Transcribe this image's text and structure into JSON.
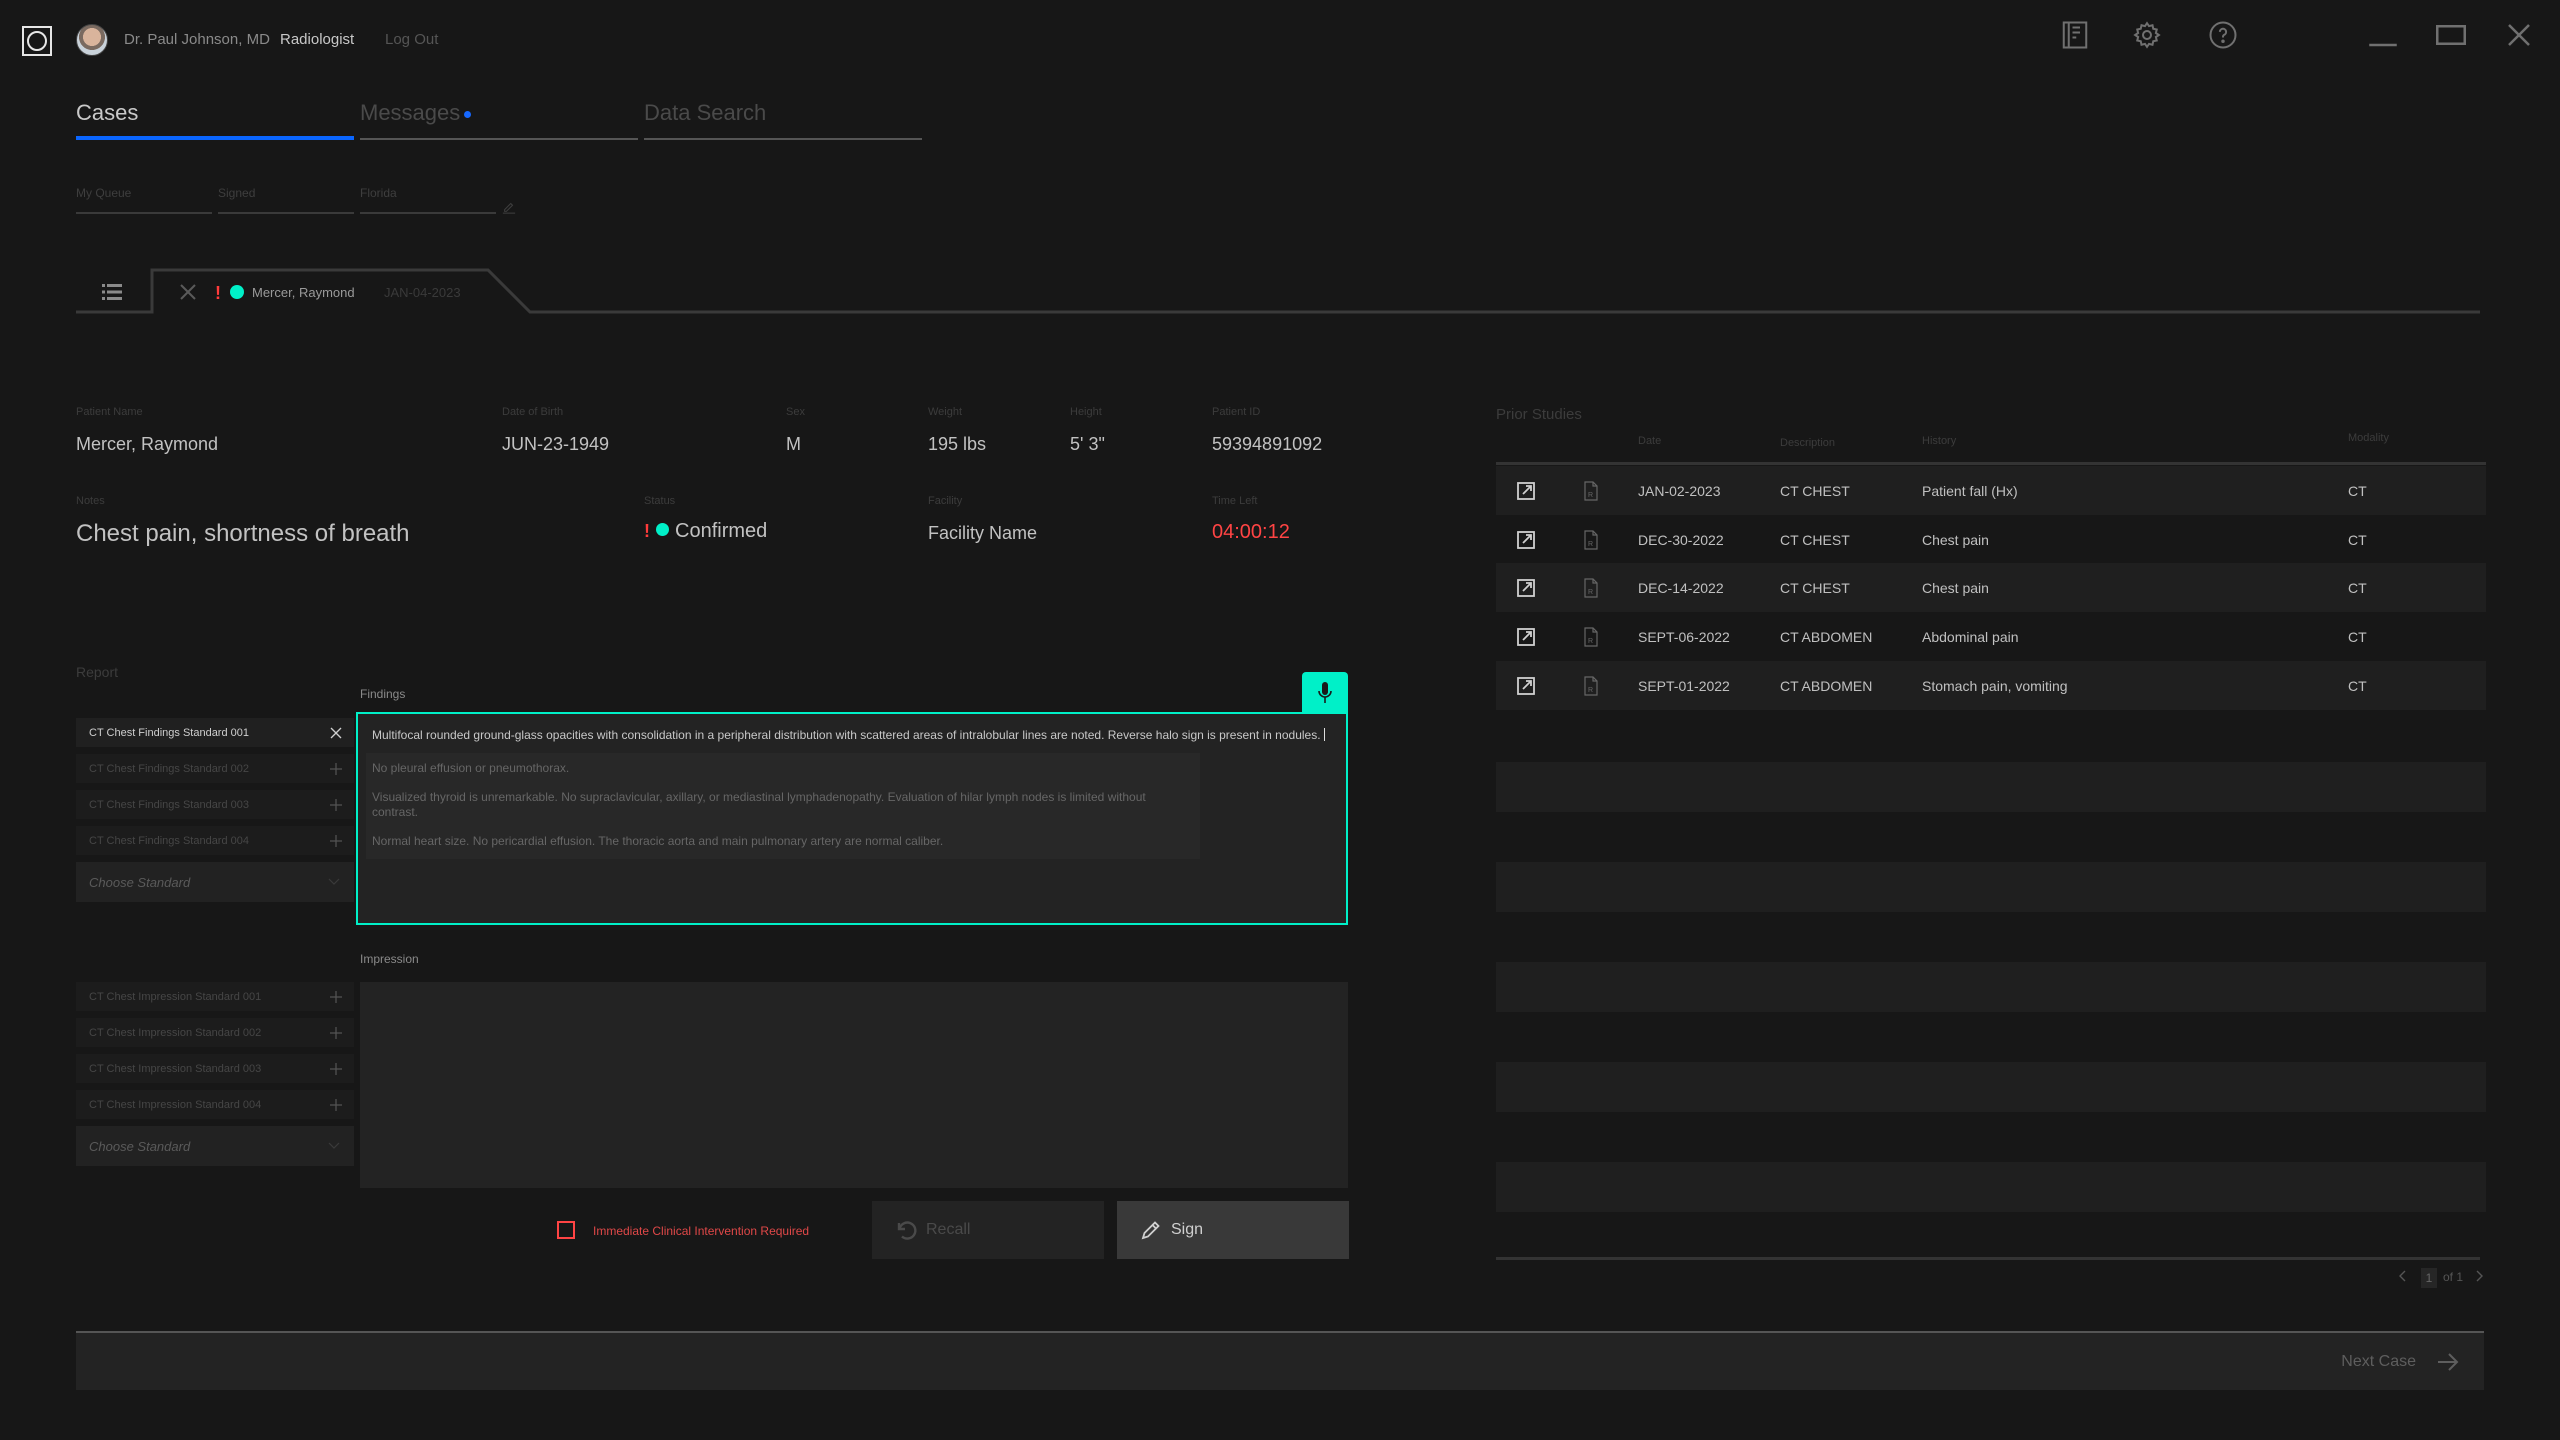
{
  "app": {
    "user_name": "Dr. Paul Johnson, MD",
    "user_role": "Radiologist",
    "logout_label": "Log Out",
    "icons": [
      "notebook-icon",
      "gear-icon",
      "help-icon",
      "minimize-icon",
      "maximize-icon",
      "close-icon"
    ]
  },
  "nav": {
    "tabs": [
      {
        "label": "Cases",
        "active": true
      },
      {
        "label": "Messages",
        "has_notification": true
      },
      {
        "label": "Data Search"
      }
    ]
  },
  "filters": [
    {
      "label": "My Queue"
    },
    {
      "label": "Signed"
    },
    {
      "label": "Florida"
    }
  ],
  "case_tab": {
    "patient_name": "Mercer, Raymond",
    "date": "JAN-04-2023",
    "priority_flag": "!",
    "status_color": "#00f0c8"
  },
  "patient": {
    "name_label": "Patient Name",
    "name": "Mercer, Raymond",
    "dob_label": "Date of Birth",
    "dob": "JUN-23-1949",
    "sex_label": "Sex",
    "sex": "M",
    "weight_label": "Weight",
    "weight": "195 lbs",
    "height_label": "Height",
    "height": "5' 3\"",
    "id_label": "Patient ID",
    "id": "59394891092",
    "notes_label": "Notes",
    "notes": "Chest pain, shortness of breath",
    "status_label": "Status",
    "status_flag": "!",
    "status": "Confirmed",
    "facility_label": "Facility",
    "facility": "Facility Name",
    "time_left_label": "Time Left",
    "time_left": "04:00:12"
  },
  "report": {
    "title": "Report",
    "findings_label": "Findings",
    "findings_standards": [
      {
        "label": "CT Chest Findings Standard 001",
        "active": true
      },
      {
        "label": "CT Chest Findings Standard 002"
      },
      {
        "label": "CT Chest Findings Standard 003"
      },
      {
        "label": "CT Chest Findings Standard 004"
      }
    ],
    "findings_choose": "Choose Standard",
    "findings_text": "Multifocal rounded ground-glass opacities with consolidation in a peripheral distribution with scattered areas of intralobular lines are noted. Reverse halo sign is present in nodules.",
    "findings_suggestions": [
      "No pleural effusion or pneumothorax.",
      "Visualized thyroid is unremarkable. No supraclavicular, axillary, or mediastinal lymphadenopathy. Evaluation of hilar lymph nodes is limited without contrast.",
      "Normal heart size. No pericardial effusion. The thoracic aorta and main pulmonary artery are normal caliber."
    ],
    "impression_label": "Impression",
    "impression_standards": [
      {
        "label": "CT Chest Impression Standard 001"
      },
      {
        "label": "CT Chest Impression Standard 002"
      },
      {
        "label": "CT Chest Impression Standard 003"
      },
      {
        "label": "CT Chest Impression Standard 004"
      }
    ],
    "impression_choose": "Choose Standard",
    "impression_text": "",
    "critical_label": "Immediate Clinical Intervention Required",
    "critical_checked": false,
    "recall_label": "Recall",
    "sign_label": "Sign",
    "accent_color": "#00f0c8",
    "alert_color": "#ff4444"
  },
  "prior_studies": {
    "title": "Prior Studies",
    "columns": [
      "Date",
      "Description",
      "History",
      "Modality"
    ],
    "rows": [
      {
        "date": "JAN-02-2023",
        "description": "CT CHEST",
        "history": "Patient fall (Hx)",
        "modality": "CT"
      },
      {
        "date": "DEC-30-2022",
        "description": "CT CHEST",
        "history": "Chest pain",
        "modality": "CT"
      },
      {
        "date": "DEC-14-2022",
        "description": "CT CHEST",
        "history": "Chest pain",
        "modality": "CT"
      },
      {
        "date": "SEPT-06-2022",
        "description": "CT ABDOMEN",
        "history": "Abdominal pain",
        "modality": "CT"
      },
      {
        "date": "SEPT-01-2022",
        "description": "CT ABDOMEN",
        "history": "Stomach pain, vomiting",
        "modality": "CT"
      }
    ],
    "pagination": {
      "current": "1",
      "of_label": "of 1"
    }
  },
  "footer": {
    "next_case_label": "Next Case"
  }
}
